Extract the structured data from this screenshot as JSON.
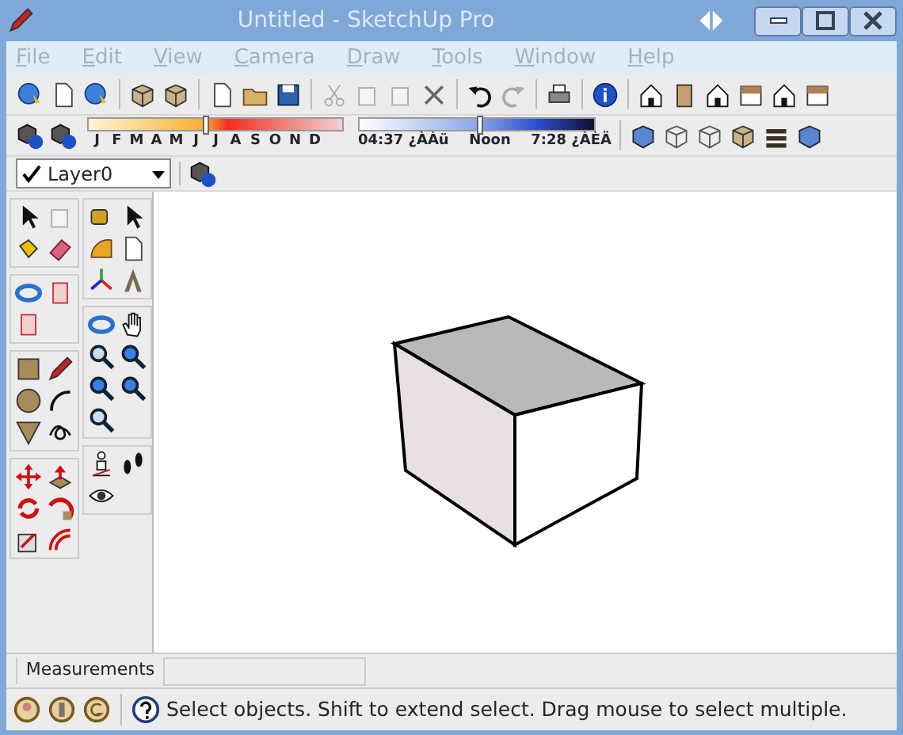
{
  "window": {
    "title": "Untitled - SketchUp Pro",
    "active": false
  },
  "menu": [
    "File",
    "Edit",
    "View",
    "Camera",
    "Draw",
    "Tools",
    "Window",
    "Help"
  ],
  "shadow_toolbar": {
    "months": [
      "J",
      "F",
      "M",
      "A",
      "M",
      "J",
      "J",
      "A",
      "S",
      "O",
      "N",
      "D"
    ],
    "date_slider": {
      "level": 0.47
    },
    "time_start": "04:37 ¿ÀÀü",
    "time_noon": "Noon",
    "time_end": "7:28 ¿ÀÈÄ",
    "time_slider": {
      "level": 0.52
    }
  },
  "layer": {
    "name": "Layer0",
    "current": true
  },
  "measurements": {
    "label": "Measurements"
  },
  "status_bar": {
    "text": "Select objects. Shift to extend select. Drag mouse to select multiple."
  }
}
